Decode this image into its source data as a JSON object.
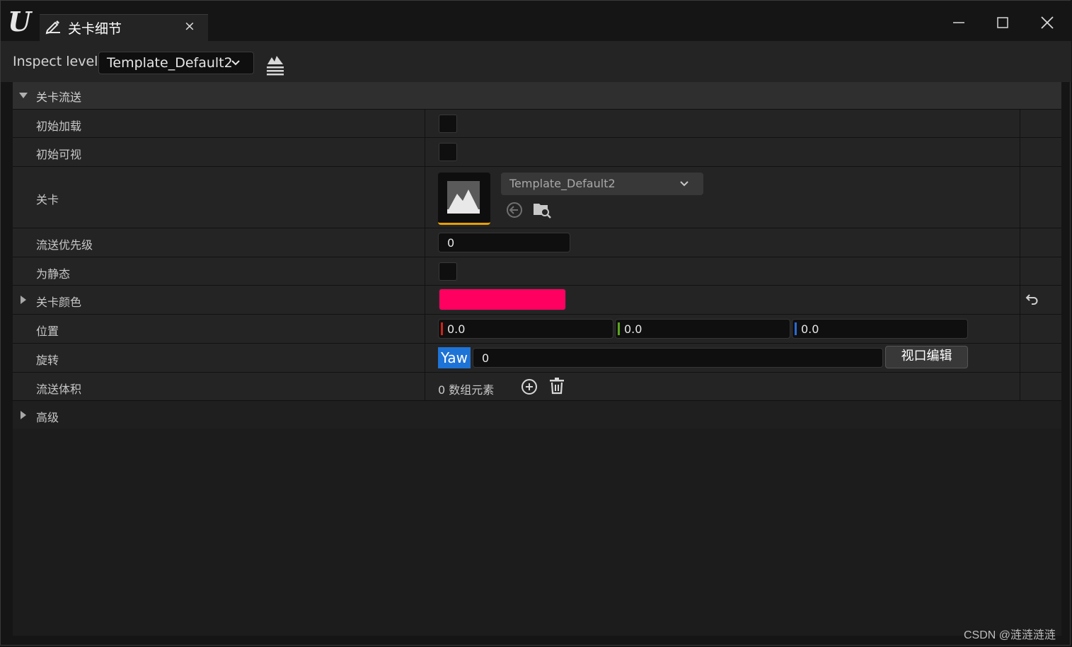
{
  "tab": {
    "title": "关卡细节",
    "close_glyph": "×",
    "icon": "edit-pencil-icon"
  },
  "window_controls": {
    "minimize": "minimize-icon",
    "maximize": "maximize-icon",
    "close": "close-icon"
  },
  "inspect": {
    "label": "Inspect level:",
    "selected": "Template_Default2",
    "level_icon": "level-map-icon"
  },
  "category": {
    "label": "关卡流送",
    "expanded": true
  },
  "properties": {
    "initially_loaded": {
      "label": "初始加载",
      "checked": false
    },
    "initially_visible": {
      "label": "初始可视",
      "checked": false
    },
    "level": {
      "label": "关卡",
      "asset": "Template_Default2"
    },
    "streaming_priority": {
      "label": "流送优先级",
      "value": "0"
    },
    "is_static": {
      "label": "为静态",
      "checked": false
    },
    "level_color": {
      "label": "关卡颜色",
      "color": "#ff0060"
    },
    "position": {
      "label": "位置",
      "x": "0.0",
      "y": "0.0",
      "z": "0.0"
    },
    "rotation": {
      "label": "旋转",
      "axis": "Yaw",
      "value": "0",
      "button": "视口编辑"
    },
    "streaming_volumes": {
      "label": "流送体积",
      "count_text": "0 数组元素"
    }
  },
  "advanced": {
    "label": "高级"
  },
  "watermark": "CSDN @涟涟涟涟",
  "colors": {
    "accent_orange": "#e8a000",
    "x_axis": "#c8261c",
    "y_axis": "#5aa51e",
    "z_axis": "#2a6ad4",
    "yaw_blue": "#1e73d6"
  }
}
